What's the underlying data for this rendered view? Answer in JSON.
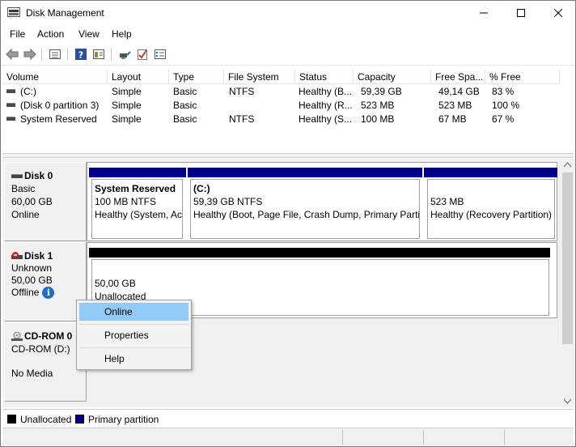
{
  "window": {
    "title": "Disk Management"
  },
  "menu": [
    "File",
    "Action",
    "View",
    "Help"
  ],
  "toolbar_icons": [
    "back-arrow-icon",
    "forward-arrow-icon",
    "list-view-icon",
    "help-icon",
    "toggle-view-icon",
    "connect-icon",
    "check-icon",
    "properties-icon"
  ],
  "columns": [
    "Volume",
    "Layout",
    "Type",
    "File System",
    "Status",
    "Capacity",
    "Free Spa...",
    "% Free"
  ],
  "volumes": [
    {
      "volume": "(C:)",
      "layout": "Simple",
      "type": "Basic",
      "fs": "NTFS",
      "status": "Healthy (B...",
      "capacity": "59,39 GB",
      "free": "49,14 GB",
      "pct": "83 %"
    },
    {
      "volume": "(Disk 0 partition 3)",
      "layout": "Simple",
      "type": "Basic",
      "fs": "",
      "status": "Healthy (R...",
      "capacity": "523 MB",
      "free": "523 MB",
      "pct": "100 %"
    },
    {
      "volume": "System Reserved",
      "layout": "Simple",
      "type": "Basic",
      "fs": "NTFS",
      "status": "Healthy (S...",
      "capacity": "100 MB",
      "free": "67 MB",
      "pct": "67 %"
    }
  ],
  "disks": [
    {
      "name": "Disk 0",
      "type": "Basic",
      "size": "60,00 GB",
      "state": "Online",
      "partitions": [
        {
          "title": "System Reserved",
          "size": "100 MB NTFS",
          "status": "Healthy (System, Ac"
        },
        {
          "title": "(C:)",
          "size": "59,39 GB NTFS",
          "status": "Healthy (Boot, Page File, Crash Dump, Primary Partit"
        },
        {
          "title": "",
          "size": "523 MB",
          "status": "Healthy (Recovery Partition)"
        }
      ]
    },
    {
      "name": "Disk 1",
      "type": "Unknown",
      "size": "50,00 GB",
      "state": "Offline",
      "partitions": [
        {
          "title": "",
          "size": "50,00 GB",
          "status": "Unallocated"
        }
      ]
    },
    {
      "name": "CD-ROM 0",
      "type": "CD-ROM (D:)",
      "size": "",
      "state": "No Media",
      "partitions": []
    }
  ],
  "context_menu": [
    "Online",
    "Properties",
    "Help"
  ],
  "legend": [
    {
      "label": "Unallocated",
      "color": "#000000"
    },
    {
      "label": "Primary partition",
      "color": "#00008b"
    }
  ],
  "colors": {
    "primary_partition": "#00008b",
    "unallocated": "#000000",
    "menu_highlight": "#91c9f7",
    "info_badge": "#1c6fc4"
  }
}
